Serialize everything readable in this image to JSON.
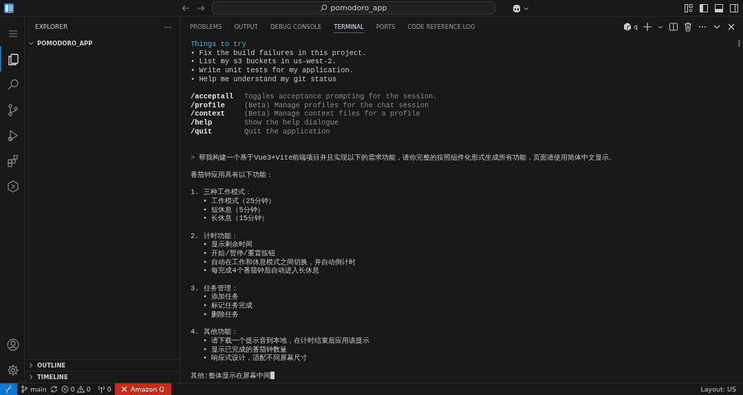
{
  "title_bar": {
    "search": {
      "value": "pomodoro_app"
    }
  },
  "activity_bar": {
    "items": [
      {
        "kind": "explorer",
        "selected": true
      },
      {
        "kind": "search",
        "selected": false
      },
      {
        "kind": "scm",
        "selected": false
      },
      {
        "kind": "run",
        "selected": false
      },
      {
        "kind": "extensions",
        "selected": false
      },
      {
        "kind": "hexagon",
        "selected": false
      }
    ]
  },
  "sidebar": {
    "title": "EXPLORER",
    "more": "···",
    "sections": [
      {
        "label": "POMODORO_APP",
        "expanded": true
      }
    ],
    "bottom_sections": [
      {
        "label": "OUTLINE",
        "expanded": false
      },
      {
        "label": "TIMELINE",
        "expanded": false
      }
    ]
  },
  "panel": {
    "tabs": [
      {
        "label": "PROBLEMS",
        "selected": false
      },
      {
        "label": "OUTPUT",
        "selected": false
      },
      {
        "label": "DEBUG CONSOLE",
        "selected": false
      },
      {
        "label": "TERMINAL",
        "selected": true
      },
      {
        "label": "PORTS",
        "selected": false
      },
      {
        "label": "CODE REFERENCE LOG",
        "selected": false
      }
    ],
    "terminal_name": "q"
  },
  "terminal": {
    "lines": [
      {
        "kind": "heading",
        "text": "Things to try"
      },
      {
        "kind": "bullet",
        "text": "• Fix the build failures in this project."
      },
      {
        "kind": "bullet",
        "text": "• List my s3 buckets in us-west-2."
      },
      {
        "kind": "bullet",
        "text": "• Write unit tests for my application."
      },
      {
        "kind": "bullet",
        "text": "• Help me understand my git status"
      },
      {
        "kind": "blank"
      },
      {
        "kind": "command",
        "command": "/acceptall",
        "text": "Toggles acceptance prompting for the session."
      },
      {
        "kind": "command",
        "command": "/profile",
        "text": "(Beta) Manage profiles for the chat session"
      },
      {
        "kind": "command",
        "command": "/context",
        "text": "(Beta) Manage context files for a profile"
      },
      {
        "kind": "command",
        "command": "/help",
        "text": "Show the help dialogue"
      },
      {
        "kind": "command",
        "command": "/quit",
        "text": "Quit the application"
      },
      {
        "kind": "blank"
      },
      {
        "kind": "blank"
      },
      {
        "kind": "prompt",
        "prompt": ">",
        "text": "帮我构建一个基于Vue3+Vite前端项目并且实现以下的需求功能，请你完整的按照组件化形式生成所有功能，页面请使用简体中文显示。"
      },
      {
        "kind": "blank"
      },
      {
        "kind": "text",
        "text": "番茄钟应用具有以下功能："
      },
      {
        "kind": "blank"
      },
      {
        "kind": "text",
        "text": "1. 三种工作模式："
      },
      {
        "kind": "subbullet",
        "text": "• 工作模式（25分钟）"
      },
      {
        "kind": "subbullet",
        "text": "• 短休息（5分钟）"
      },
      {
        "kind": "subbullet",
        "text": "• 长休息（15分钟）"
      },
      {
        "kind": "blank"
      },
      {
        "kind": "text",
        "text": "2. 计时功能："
      },
      {
        "kind": "subbullet",
        "text": "• 显示剩余时间"
      },
      {
        "kind": "subbullet",
        "text": "• 开始/暂停/重置按钮"
      },
      {
        "kind": "subbullet",
        "text": "• 自动在工作和休息模式之间切换，并自动倒计时"
      },
      {
        "kind": "subbullet",
        "text": "• 每完成4个番茄钟后自动进入长休息"
      },
      {
        "kind": "blank"
      },
      {
        "kind": "text",
        "text": "3. 任务管理："
      },
      {
        "kind": "subbullet",
        "text": "• 添加任务"
      },
      {
        "kind": "subbullet",
        "text": "• 标记任务完成"
      },
      {
        "kind": "subbullet",
        "text": "• 删除任务"
      },
      {
        "kind": "blank"
      },
      {
        "kind": "text",
        "text": "4. 其他功能："
      },
      {
        "kind": "subbullet",
        "text": "• 请下载一个提示音到本地，在计时结束后应用该提示"
      },
      {
        "kind": "subbullet",
        "text": "• 显示已完成的番茄钟数量"
      },
      {
        "kind": "subbullet",
        "text": "• 响应式设计，适配不同屏幕尺寸"
      },
      {
        "kind": "blank"
      },
      {
        "kind": "input",
        "text": "其他:整体显示在屏幕中间"
      }
    ]
  },
  "status_bar": {
    "branch": "main",
    "errors": "0",
    "warnings": "0",
    "ports": "0",
    "amazon_q": "Amazon Q",
    "layout": "Layout: US"
  }
}
